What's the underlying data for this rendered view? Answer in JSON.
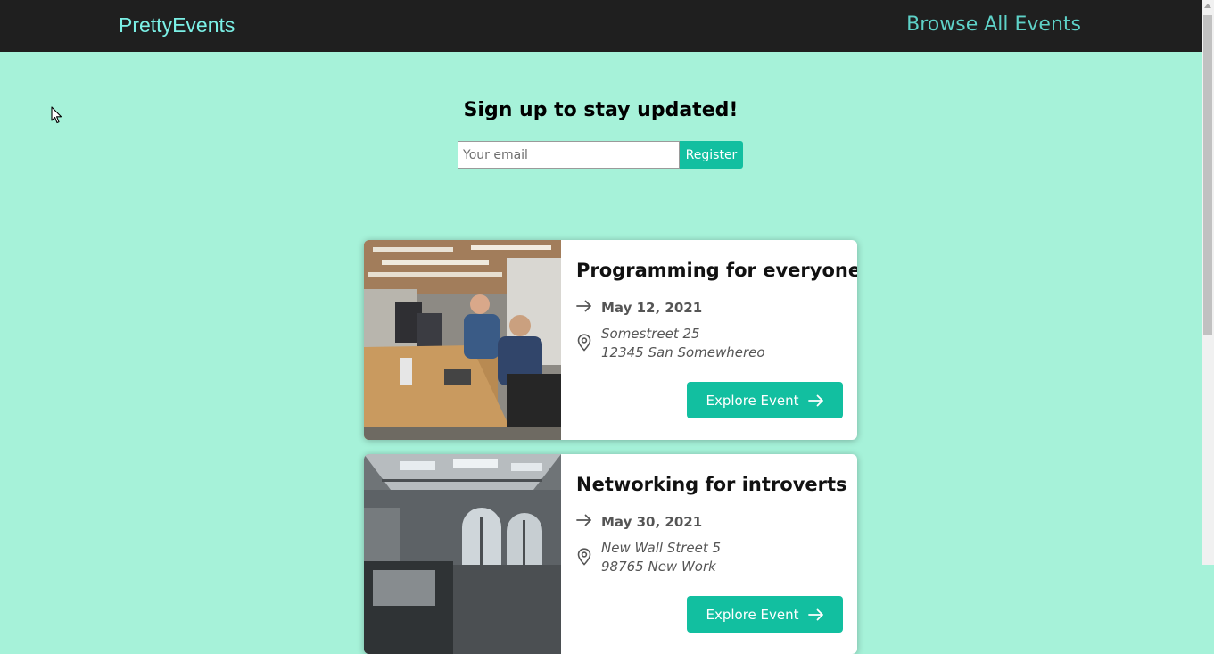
{
  "header": {
    "brand": "PrettyEvents",
    "nav_link": "Browse All Events"
  },
  "signup": {
    "title": "Sign up to stay updated!",
    "email_placeholder": "Your email",
    "register_label": "Register"
  },
  "events": [
    {
      "title": "Programming for everyone",
      "date": "May 12, 2021",
      "address_line1": "Somestreet 25",
      "address_line2": "12345 San Somewhereo",
      "button_label": "Explore Event"
    },
    {
      "title": "Networking for introverts",
      "date": "May 30, 2021",
      "address_line1": "New Wall Street 5",
      "address_line2": "98765 New Work",
      "button_label": "Explore Event"
    }
  ],
  "icons": {
    "date": "arrow-right-icon",
    "location": "map-pin-icon",
    "button": "arrow-right-icon"
  },
  "colors": {
    "page_background": "#a6f2d9",
    "header_background": "#1f1f1f",
    "brand": "#7bf0e6",
    "nav_link": "#5ed2c8",
    "accent": "#12bfa0"
  }
}
